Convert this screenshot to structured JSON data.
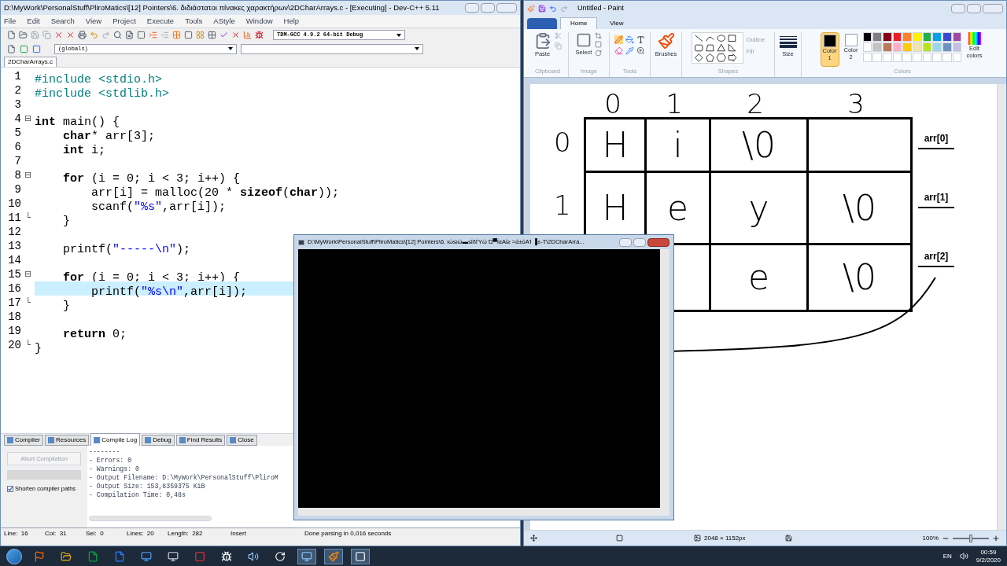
{
  "devcpp": {
    "title": "D:\\MyWork\\PersonalStuff\\PliroMatics\\[12] Pointers\\6. διδιάστατοι πίνακες χαρακτήρων\\2DCharArrays.c - [Executing] - Dev-C++ 5.11",
    "menu": [
      "File",
      "Edit",
      "Search",
      "View",
      "Project",
      "Execute",
      "Tools",
      "AStyle",
      "Window",
      "Help"
    ],
    "compiler": "TDM-GCC 4.9.2 64-bit Debug",
    "scope": "(globals)",
    "file_tabs": [
      {
        "label": "2DCharArrays.c",
        "selected": true
      }
    ],
    "code": [
      {
        "number": "1",
        "current": false,
        "tokens": [
          {
            "kind": "preproc",
            "text": "#include <stdio.h>"
          }
        ]
      },
      {
        "number": "2",
        "current": false,
        "tokens": [
          {
            "kind": "preproc",
            "text": "#include <stdlib.h>"
          }
        ]
      },
      {
        "number": "3",
        "current": false
      },
      {
        "number": "4",
        "current": false,
        "fold": "⊟",
        "tokens": [
          {
            "kind": "keyword",
            "text": "int"
          },
          {
            "kind": "plain",
            "text": " main() {"
          }
        ]
      },
      {
        "number": "5",
        "current": false,
        "tokens": [
          {
            "kind": "keyword",
            "text": "    char"
          },
          {
            "kind": "plain",
            "text": "* arr[3];"
          }
        ]
      },
      {
        "number": "6",
        "current": false,
        "tokens": [
          {
            "kind": "keyword",
            "text": "    int"
          },
          {
            "kind": "plain",
            "text": " i;"
          }
        ]
      },
      {
        "number": "7",
        "current": false
      },
      {
        "number": "8",
        "current": false,
        "fold": "⊟",
        "tokens": [
          {
            "kind": "keyword",
            "text": "    for"
          },
          {
            "kind": "plain",
            "text": " (i = 0; i < 3; i++) {"
          }
        ]
      },
      {
        "number": "9",
        "current": false,
        "tokens": [
          {
            "kind": "plain",
            "text": "        arr[i] = malloc(20 * "
          },
          {
            "kind": "keyword",
            "text": "sizeof"
          },
          {
            "kind": "plain",
            "text": "("
          },
          {
            "kind": "keyword",
            "text": "char"
          },
          {
            "kind": "plain",
            "text": "));"
          }
        ]
      },
      {
        "number": "10",
        "current": false,
        "tokens": [
          {
            "kind": "plain",
            "text": "        scanf("
          },
          {
            "kind": "string",
            "text": "\"%s\""
          },
          {
            "kind": "plain",
            "text": ",arr[i]);"
          }
        ]
      },
      {
        "number": "11",
        "current": false,
        "fold": "└",
        "tokens": [
          {
            "kind": "plain",
            "text": "    }"
          }
        ]
      },
      {
        "number": "12",
        "current": false
      },
      {
        "number": "13",
        "current": false,
        "tokens": [
          {
            "kind": "plain",
            "text": "    printf("
          },
          {
            "kind": "string",
            "text": "\"-----\\n\""
          },
          {
            "kind": "plain",
            "text": ");"
          }
        ]
      },
      {
        "number": "14",
        "current": false
      },
      {
        "number": "15",
        "current": false,
        "fold": "⊟",
        "tokens": [
          {
            "kind": "keyword",
            "text": "    for"
          },
          {
            "kind": "plain",
            "text": " (i = 0; i < 3; i++) {"
          }
        ]
      },
      {
        "number": "16",
        "current": true,
        "tokens": [
          {
            "kind": "plain",
            "text": "        printf("
          },
          {
            "kind": "string",
            "text": "\"%s\\n\""
          },
          {
            "kind": "plain",
            "text": ",arr[i]);"
          }
        ]
      },
      {
        "number": "17",
        "current": false,
        "fold": "└",
        "tokens": [
          {
            "kind": "plain",
            "text": "    }"
          }
        ]
      },
      {
        "number": "18",
        "current": false
      },
      {
        "number": "19",
        "current": false,
        "tokens": [
          {
            "kind": "keyword",
            "text": "    return"
          },
          {
            "kind": "plain",
            "text": " 0;"
          }
        ]
      },
      {
        "number": "20",
        "current": false,
        "fold": "└",
        "tokens": [
          {
            "kind": "plain",
            "text": "}"
          }
        ]
      }
    ],
    "bottom_tabs": [
      {
        "label": "Compiler",
        "selected": false
      },
      {
        "label": "Resources",
        "selected": false
      },
      {
        "label": "Compile Log",
        "selected": true
      },
      {
        "label": "Debug",
        "selected": false
      },
      {
        "label": "Find Results",
        "selected": false
      },
      {
        "label": "Close",
        "selected": false
      }
    ],
    "abort_button": {
      "label": "Abort Compilation",
      "disabled": true
    },
    "shorten_paths": {
      "label": "Shorten compiler paths",
      "checked": true
    },
    "log": [
      "--------",
      "- Errors: 0",
      "- Warnings: 0",
      "- Output Filename: D:\\MyWork\\PersonalStuff\\PliroM",
      "- Output Size: 153,8359375 KiB",
      "- Compilation Time: 0,48s"
    ],
    "status": [
      {
        "label": "Line:",
        "value": "16"
      },
      {
        "label": "Col:",
        "value": "31"
      },
      {
        "label": "Sel:",
        "value": "0"
      },
      {
        "label": "Lines:",
        "value": "20"
      },
      {
        "label": "Length:",
        "value": "282"
      },
      {
        "value": "Insert"
      },
      {
        "value": "Done parsing in 0,016 seconds"
      }
    ]
  },
  "paint": {
    "title": "Untitled - Paint",
    "tabs": [
      {
        "label": "Home",
        "selected": true
      },
      {
        "label": "View",
        "selected": false
      }
    ],
    "paste": "Paste",
    "select": "Select",
    "brushes": "Brushes",
    "size": "Size",
    "outline": {
      "label": "Outline",
      "disabled": true
    },
    "fill": {
      "label": "Fill",
      "disabled": true
    },
    "color1": {
      "label": "Color 1",
      "color": "#000000",
      "selected": true
    },
    "color2": {
      "label": "Color 2",
      "color": "#ffffff",
      "selected": false
    },
    "edit_colors": "Edit colors",
    "group_labels": [
      "Clipboard",
      "Image",
      "Tools",
      "Shapes",
      "Colors"
    ],
    "palette": [
      {
        "color": "#000000"
      },
      {
        "color": "#7f7f7f"
      },
      {
        "color": "#880015"
      },
      {
        "color": "#ed1c24"
      },
      {
        "color": "#ff7f27"
      },
      {
        "color": "#fff200"
      },
      {
        "color": "#22b14c"
      },
      {
        "color": "#00a2e8"
      },
      {
        "color": "#3f48cc"
      },
      {
        "color": "#a349a4"
      },
      {
        "color": "#ffffff"
      },
      {
        "color": "#c3c3c3"
      },
      {
        "color": "#b97a57"
      },
      {
        "color": "#ffaec9"
      },
      {
        "color": "#ffc90e"
      },
      {
        "color": "#efe4b0"
      },
      {
        "color": "#b5e61d"
      },
      {
        "color": "#99d9ea"
      },
      {
        "color": "#7092be"
      },
      {
        "color": "#c8bfe7"
      }
    ],
    "canvas": {
      "column_headers": [
        "0",
        "1",
        "2",
        "3"
      ],
      "row_headers": [
        "0",
        "1"
      ],
      "rows": [
        [
          "H",
          "i",
          "\\0",
          null
        ],
        [
          "H",
          "e",
          "y",
          "\\0"
        ],
        [
          null,
          null,
          "e",
          "\\0"
        ]
      ],
      "pointer_labels": [
        "arr[0]",
        "arr[1]",
        "arr[2]"
      ]
    },
    "image_size": "2048 × 1152px",
    "zoom": {
      "reading": "100%",
      "level": 0.5
    }
  },
  "console": {
    "title": "D:\\MyWork\\PersonalStuff\\PliroMatics\\[12] Pointers\\6. ιώ≤ιώ▬≤ĺδĺΎώ Ώ▀ĺαΑί≥ =ά±όΑΊ ▐±-Τ\\2DCharArra..."
  },
  "taskbar": {
    "language": "EN",
    "time": "00:59",
    "date": "9/2/2020"
  }
}
